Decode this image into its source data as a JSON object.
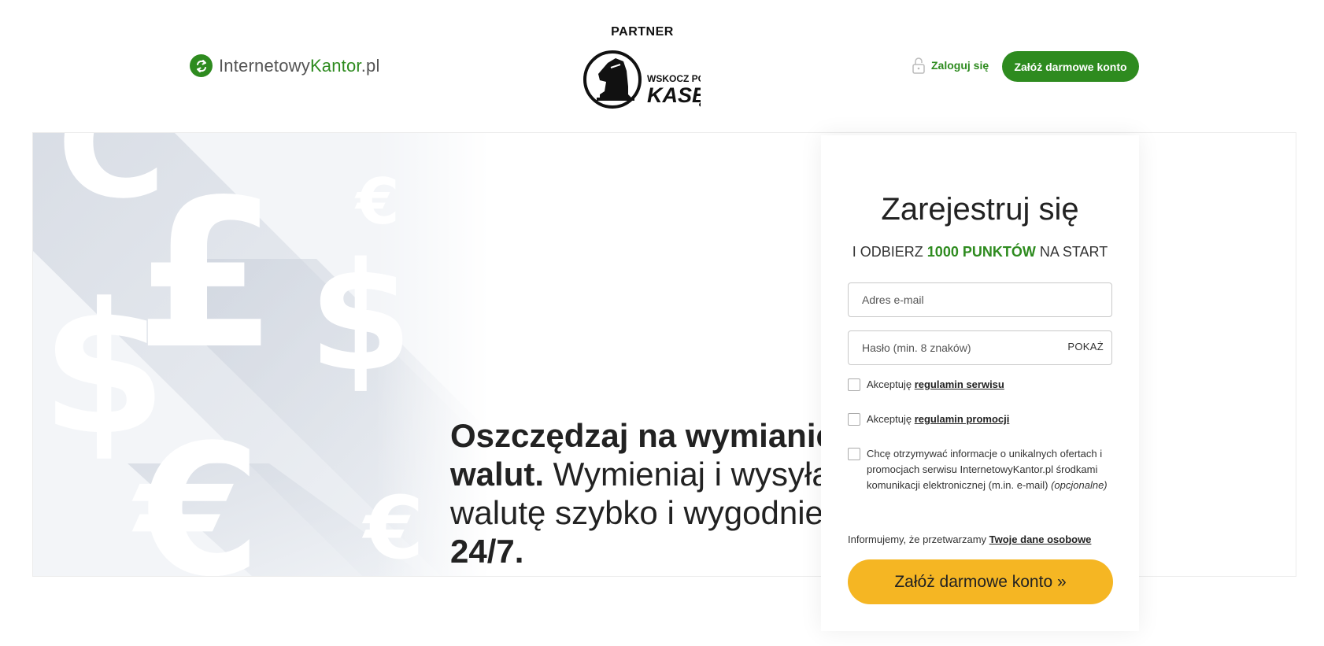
{
  "header": {
    "logo_prefix": "Internetowy",
    "logo_highlight": "Kantor",
    "logo_suffix": ".pl",
    "partner_label": "PARTNER",
    "partner_logo_line1": "WSKOCZ PO",
    "partner_logo_line2": "KASĘ",
    "login_label": "Zaloguj się",
    "cta_label": "Załóż darmowe konto"
  },
  "hero": {
    "headline_bold_1": "Oszczędzaj na wymianie walut.",
    "headline_regular": " Wymieniaj i wysyłaj walutę szybko i wygodnie ",
    "headline_bold_2": "24/7."
  },
  "form": {
    "title": "Zarejestruj się",
    "subtitle_prefix": "I ODBIERZ ",
    "subtitle_highlight": "1000 PUNKTÓW",
    "subtitle_suffix": " NA START",
    "email_placeholder": "Adres e-mail",
    "password_placeholder": "Hasło (min. 8 znaków)",
    "show_password": "POKAŻ",
    "terms_prefix": "Akceptuję ",
    "terms_link": "regulamin serwisu",
    "promo_prefix": "Akceptuję ",
    "promo_link": "regulamin promocji",
    "marketing_text": "Chcę otrzymywać informacje o unikalnych ofertach i promocjach serwisu InternetowyKantor.pl środkami komunikacji elektronicznej (m.in. e-mail) ",
    "marketing_optional": "(opcjonalne)",
    "privacy_prefix": "Informujemy, że przetwarzamy ",
    "privacy_link": "Twoje dane osobowe",
    "submit_label": "Załóż darmowe konto »"
  },
  "colors": {
    "brand_green": "#2e8b1f",
    "cta_yellow": "#f5b623"
  }
}
